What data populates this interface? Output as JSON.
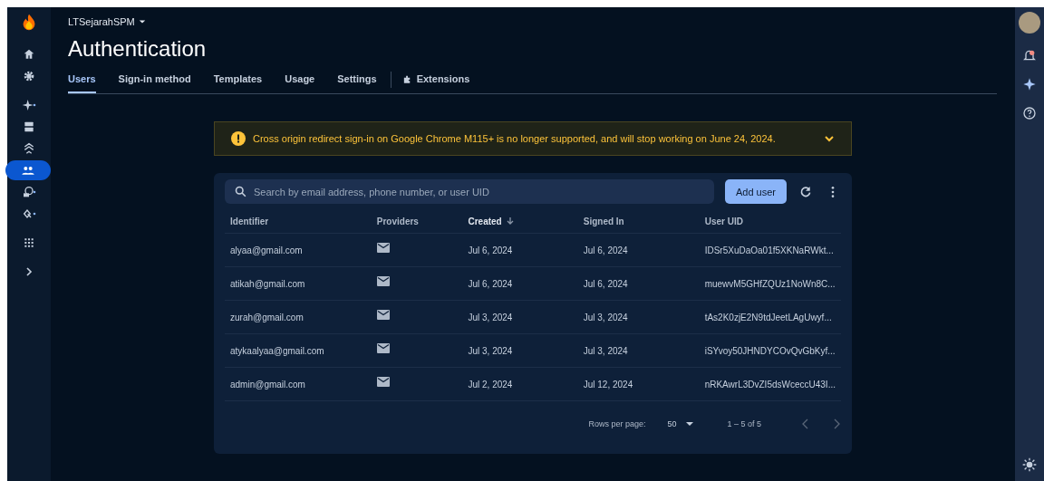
{
  "sidebar": {
    "items": [
      {
        "kind": "home",
        "selected": false
      },
      {
        "kind": "gear",
        "selected": false
      },
      {
        "kind": "sparkle",
        "selected": false
      },
      {
        "kind": "database",
        "selected": false
      },
      {
        "kind": "layers",
        "selected": false
      },
      {
        "kind": "users",
        "selected": true
      },
      {
        "kind": "globe",
        "selected": false
      },
      {
        "kind": "link",
        "selected": false
      },
      {
        "kind": "grid",
        "selected": false
      },
      {
        "kind": "chevron",
        "selected": false
      }
    ]
  },
  "project": "LTSejarahSPM",
  "title": "Authentication",
  "tabs": [
    {
      "label": "Users",
      "selected": true,
      "kind": "text"
    },
    {
      "label": "Sign-in method",
      "selected": false,
      "kind": "text"
    },
    {
      "label": "Templates",
      "selected": false,
      "kind": "text"
    },
    {
      "label": "Usage",
      "selected": false,
      "kind": "text"
    },
    {
      "label": "Settings",
      "selected": false,
      "kind": "text"
    },
    {
      "label": "Extensions",
      "selected": false,
      "kind": "extension"
    }
  ],
  "banner": {
    "text": "Cross origin redirect sign-in on Google Chrome M115+ is no longer supported, and will stop working on June 24, 2024."
  },
  "search": {
    "placeholder": "Search by email address, phone number, or user UID"
  },
  "add_button": "Add user",
  "table": {
    "columns": [
      {
        "label": "Identifier",
        "sorted": false
      },
      {
        "label": "Providers",
        "sorted": false
      },
      {
        "label": "Created",
        "sorted": true
      },
      {
        "label": "Signed In",
        "sorted": false
      },
      {
        "label": "User UID",
        "sorted": false
      }
    ],
    "rows": [
      {
        "identifier": "alyaa@gmail.com",
        "created": "Jul 6, 2024",
        "signed_in": "Jul 6, 2024",
        "uid": "IDSr5XuDaOa01f5XKNaRWkt..."
      },
      {
        "identifier": "atikah@gmail.com",
        "created": "Jul 6, 2024",
        "signed_in": "Jul 6, 2024",
        "uid": "muewvM5GHfZQUz1NoWn8C..."
      },
      {
        "identifier": "zurah@gmail.com",
        "created": "Jul 3, 2024",
        "signed_in": "Jul 3, 2024",
        "uid": "tAs2K0zjE2N9tdJeetLAgUwyf..."
      },
      {
        "identifier": "atykaalyaa@gmail.com",
        "created": "Jul 3, 2024",
        "signed_in": "Jul 3, 2024",
        "uid": "iSYvoy50JHNDYCOvQvGbKyf..."
      },
      {
        "identifier": "admin@gmail.com",
        "created": "Jul 2, 2024",
        "signed_in": "Jul 12, 2024",
        "uid": "nRKAwrL3DvZI5dsWceccU43I..."
      }
    ]
  },
  "pagination": {
    "rows_label": "Rows per page:",
    "rows_value": "50",
    "range": "1 – 5 of 5"
  }
}
